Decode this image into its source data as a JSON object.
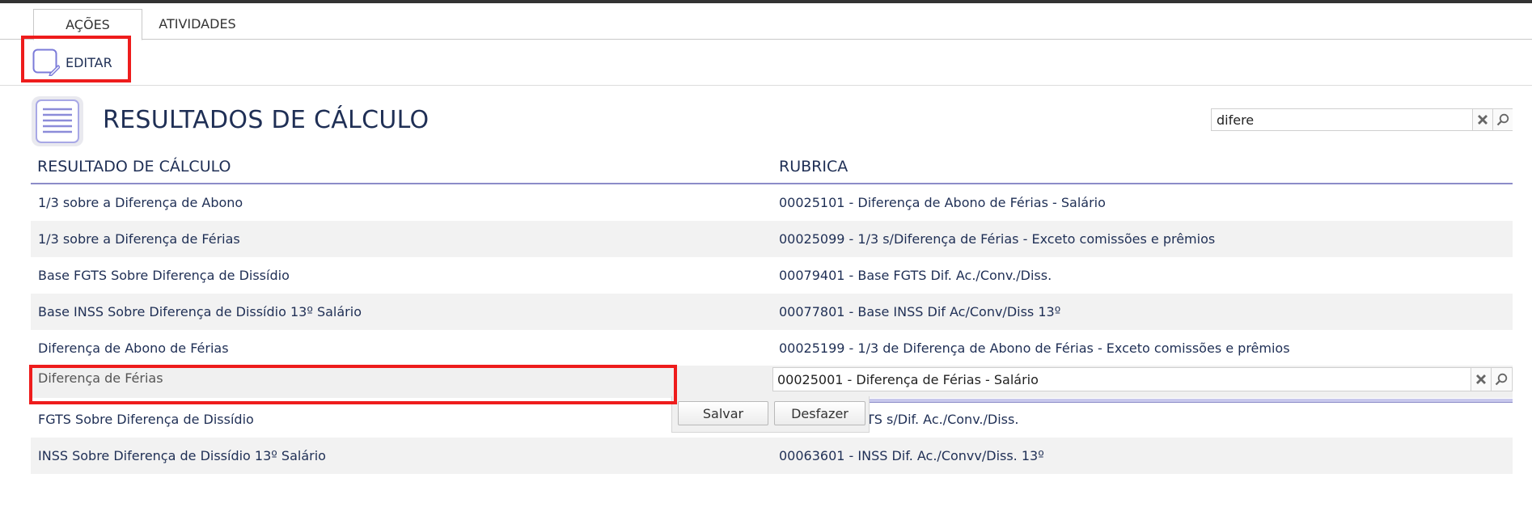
{
  "tabs": [
    {
      "label": "AÇÕES",
      "active": true
    },
    {
      "label": "ATIVIDADES",
      "active": false
    }
  ],
  "toolbar": {
    "edit_label": "EDITAR"
  },
  "page": {
    "title": "RESULTADOS DE CÁLCULO"
  },
  "search": {
    "value": "difere"
  },
  "table": {
    "columns": [
      "RESULTADO DE CÁLCULO",
      "RUBRICA"
    ],
    "rows": [
      {
        "result": "1/3 sobre a Diferença de Abono",
        "rubric": "00025101 - Diferença de Abono de Férias - Salário"
      },
      {
        "result": "1/3 sobre a Diferença de Férias",
        "rubric": "00025099 - 1/3 s/Diferença de Férias - Exceto comissões e prêmios"
      },
      {
        "result": "Base FGTS Sobre Diferença de Dissídio",
        "rubric": "00079401 - Base FGTS Dif. Ac./Conv./Diss."
      },
      {
        "result": "Base INSS Sobre Diferença de Dissídio 13º Salário",
        "rubric": "00077801 - Base INSS Dif Ac/Conv/Diss 13º"
      },
      {
        "result": "Diferença de Abono de Férias",
        "rubric": "00025199 - 1/3 de Diferença de Abono de Férias - Exceto comissões e prêmios"
      }
    ],
    "editing_row": {
      "result": "Diferença de Férias",
      "rubric": "00025001 - Diferença de Férias - Salário"
    },
    "rows_after": [
      {
        "result": "FGTS Sobre Diferença de Dissídio",
        "rubric": "TS s/Dif. Ac./Conv./Diss."
      },
      {
        "result": "INSS Sobre Diferença de Dissídio 13º Salário",
        "rubric": "00063601 - INSS Dif. Ac./Convv/Diss. 13º"
      }
    ]
  },
  "actions": {
    "save_label": "Salvar",
    "undo_label": "Desfazer"
  },
  "colors": {
    "accent": "#8c8cc8",
    "highlight": "#ee1c1c",
    "text": "#1f2f55"
  }
}
